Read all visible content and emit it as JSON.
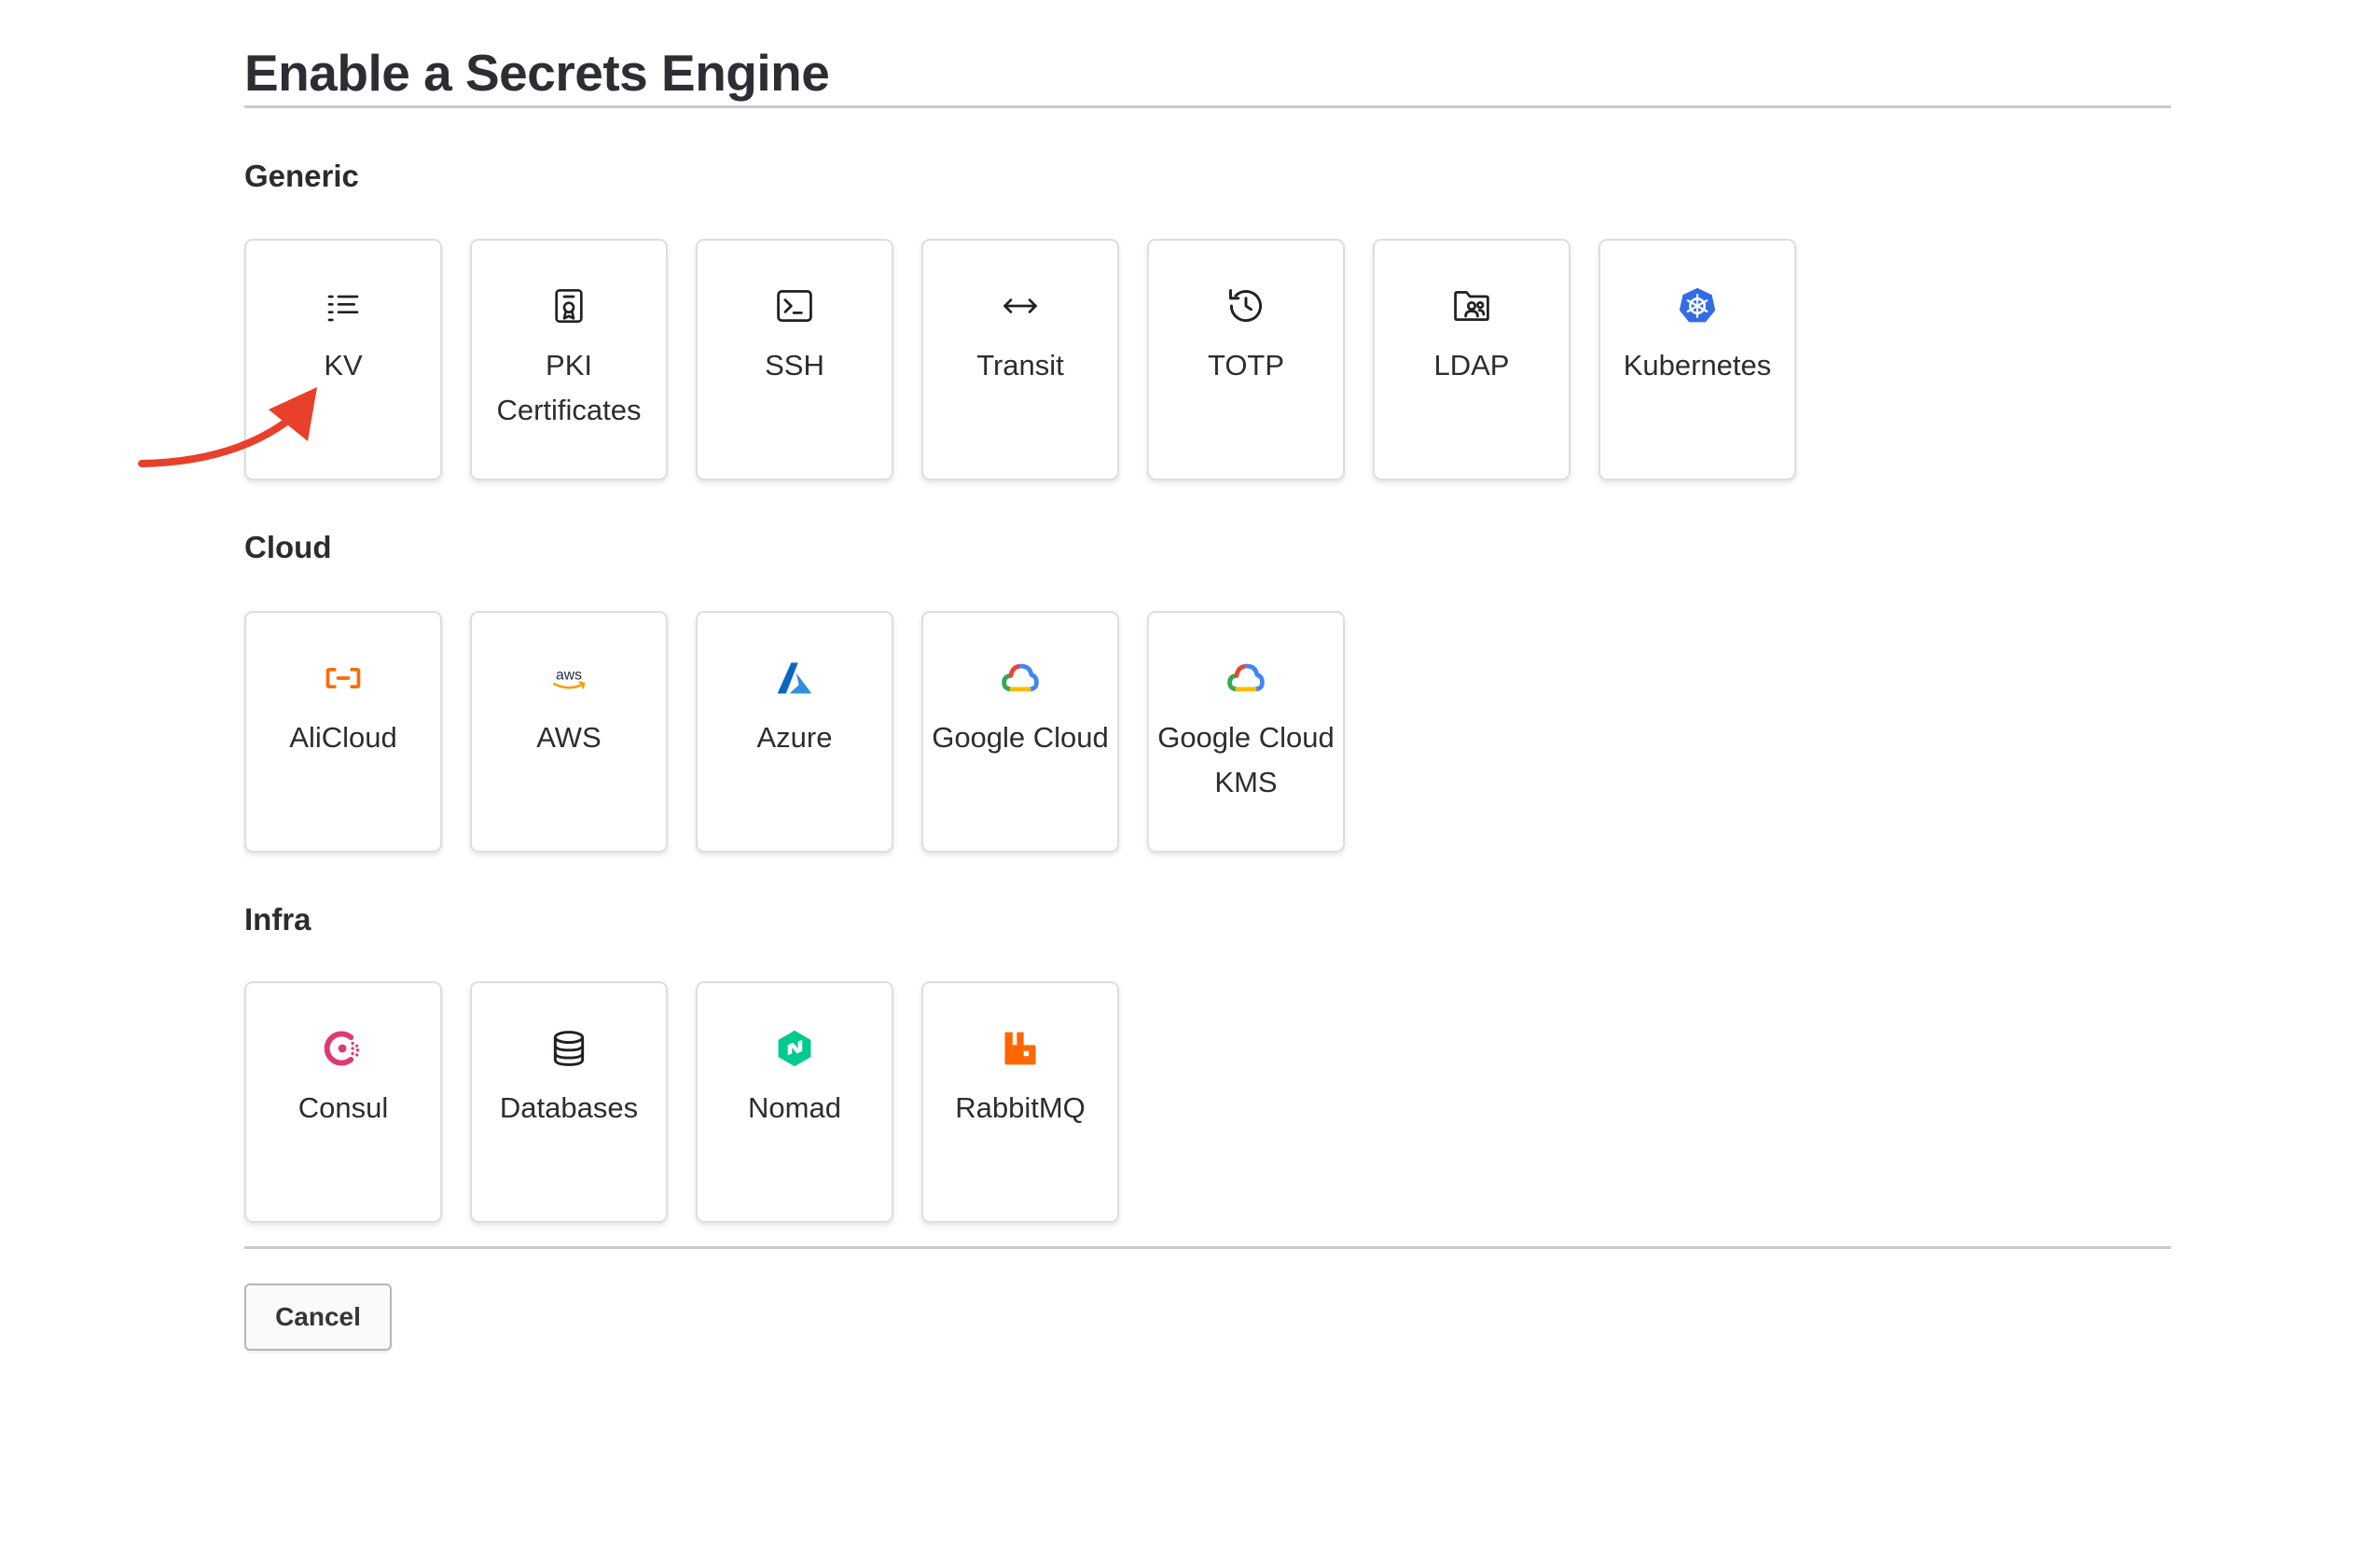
{
  "page": {
    "title": "Enable a Secrets Engine"
  },
  "sections": [
    {
      "heading": "Generic",
      "cards": [
        {
          "label": "KV",
          "icon": "list-icon"
        },
        {
          "label": "PKI Certificates",
          "icon": "certificate-icon"
        },
        {
          "label": "SSH",
          "icon": "terminal-icon"
        },
        {
          "label": "Transit",
          "icon": "arrows-left-right-icon"
        },
        {
          "label": "TOTP",
          "icon": "history-icon"
        },
        {
          "label": "LDAP",
          "icon": "folder-users-icon"
        },
        {
          "label": "Kubernetes",
          "icon": "kubernetes-icon"
        }
      ]
    },
    {
      "heading": "Cloud",
      "cards": [
        {
          "label": "AliCloud",
          "icon": "alicloud-icon"
        },
        {
          "label": "AWS",
          "icon": "aws-icon"
        },
        {
          "label": "Azure",
          "icon": "azure-icon"
        },
        {
          "label": "Google Cloud",
          "icon": "google-cloud-icon"
        },
        {
          "label": "Google Cloud KMS",
          "icon": "google-cloud-icon"
        }
      ]
    },
    {
      "heading": "Infra",
      "cards": [
        {
          "label": "Consul",
          "icon": "consul-icon"
        },
        {
          "label": "Databases",
          "icon": "database-icon"
        },
        {
          "label": "Nomad",
          "icon": "nomad-icon"
        },
        {
          "label": "RabbitMQ",
          "icon": "rabbitmq-icon"
        }
      ]
    }
  ],
  "actions": {
    "cancel_label": "Cancel"
  },
  "colors": {
    "annotation_arrow": "#e8402a",
    "kubernetes": "#326ce5",
    "alicloud": "#ff6a00",
    "aws_smile": "#ff9900",
    "azure": "#0078d4",
    "consul": "#e03875",
    "nomad": "#00ca8e",
    "rabbitmq": "#ff6600"
  }
}
